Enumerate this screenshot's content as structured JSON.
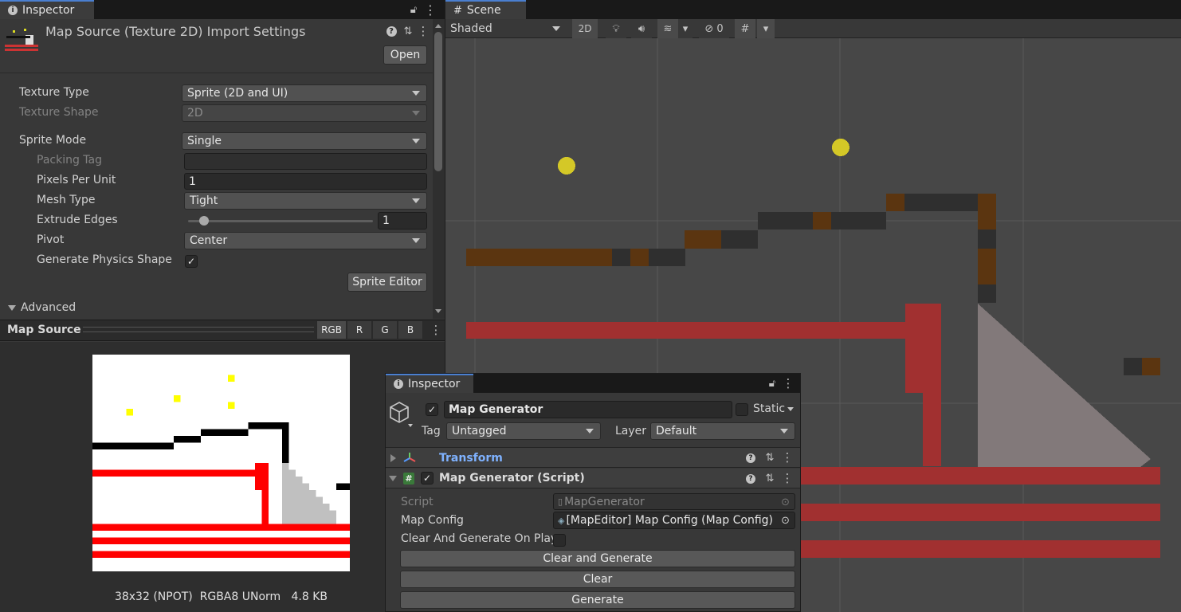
{
  "inspector_left": {
    "tab_label": "Inspector",
    "title": "Map Source (Texture 2D) Import Settings",
    "open_label": "Open",
    "fields": {
      "texture_type": {
        "label": "Texture Type",
        "value": "Sprite (2D and UI)"
      },
      "texture_shape": {
        "label": "Texture Shape",
        "value": "2D"
      },
      "sprite_mode": {
        "label": "Sprite Mode",
        "value": "Single"
      },
      "packing_tag": {
        "label": "Packing Tag",
        "value": ""
      },
      "pixels_per_unit": {
        "label": "Pixels Per Unit",
        "value": "1"
      },
      "mesh_type": {
        "label": "Mesh Type",
        "value": "Tight"
      },
      "extrude_edges": {
        "label": "Extrude Edges",
        "value": "1",
        "fraction": 0.05
      },
      "pivot": {
        "label": "Pivot",
        "value": "Center"
      },
      "generate_physics_shape": {
        "label": "Generate Physics Shape",
        "checked": true
      }
    },
    "sprite_editor_label": "Sprite Editor",
    "advanced_label": "Advanced"
  },
  "preview": {
    "title": "Map Source",
    "channels": [
      "RGB",
      "R",
      "G",
      "B"
    ],
    "info": "38x32 (NPOT)  RGBA8 UNorm   4.8 KB"
  },
  "scene": {
    "tab_label": "Scene",
    "shading_mode": "Shaded",
    "mode_2d_label": "2D",
    "hidden_count": "0"
  },
  "inspector_float": {
    "tab_label": "Inspector",
    "object_name": "Map Generator",
    "active": true,
    "static_label": "Static",
    "tag_label": "Tag",
    "tag_value": "Untagged",
    "layer_label": "Layer",
    "layer_value": "Default",
    "transform_label": "Transform",
    "component_label": "Map Generator (Script)",
    "component_enabled": true,
    "script_label": "Script",
    "script_value": "MapGenerator",
    "map_config_label": "Map Config",
    "map_config_value": "[MapEditor] Map Config (Map Config)",
    "clear_on_play_label": "Clear And Generate On Play",
    "clear_on_play_checked": false,
    "clear_generate_label": "Clear and Generate",
    "clear_label": "Clear",
    "generate_label": "Generate"
  },
  "colors": {
    "panel_bg": "#383838",
    "scene_bg": "#474747",
    "red": "#a13030",
    "brown": "#5b3510",
    "dark_tile": "#2f2f2f",
    "yellow": "#d4c827",
    "light_link": "#7fb2ff"
  }
}
